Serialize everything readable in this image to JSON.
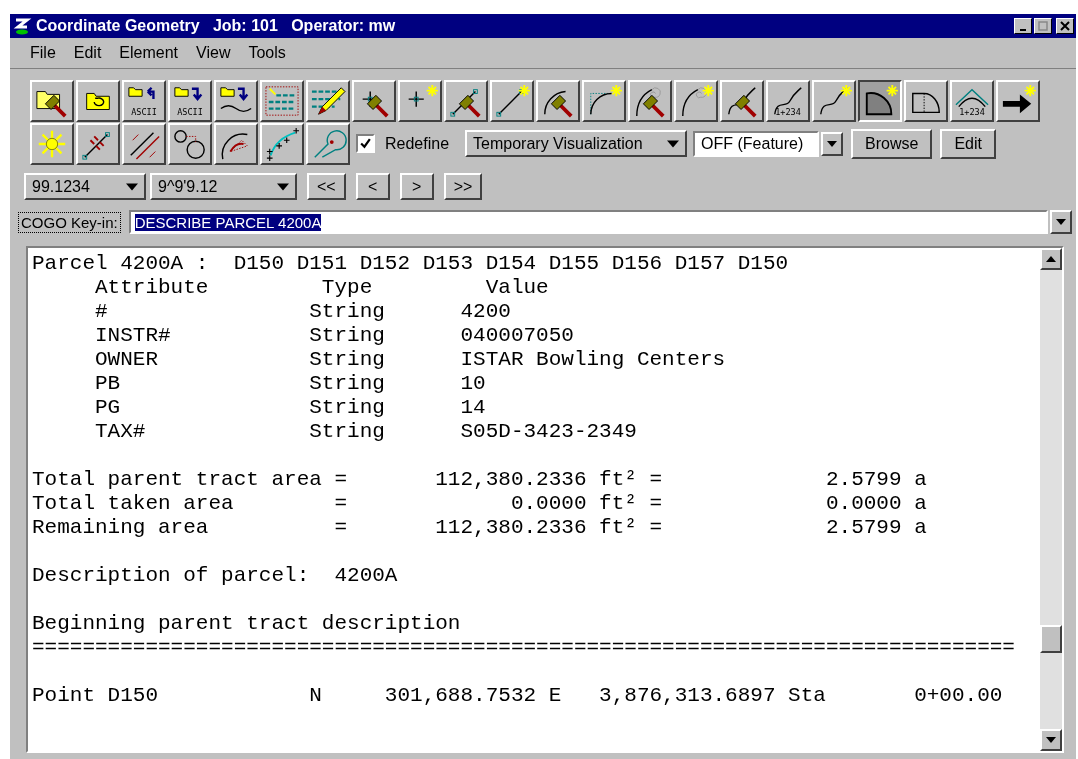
{
  "window": {
    "title": "Coordinate Geometry   Job: 101   Operator: mw"
  },
  "menu": [
    {
      "label": "File"
    },
    {
      "label": "Edit"
    },
    {
      "label": "Element"
    },
    {
      "label": "View"
    },
    {
      "label": "Tools"
    }
  ],
  "toolbar_rows": [
    [
      {
        "kind": "folder-hammer",
        "pressed": false
      },
      {
        "kind": "folder-undo",
        "pressed": false
      },
      {
        "kind": "ascii-export",
        "caption": "ASCII",
        "pressed": false
      },
      {
        "kind": "ascii-import",
        "caption": "ASCII",
        "pressed": false
      },
      {
        "kind": "folder-curve",
        "pressed": false
      },
      {
        "kind": "dotted-grid",
        "pressed": false
      },
      {
        "kind": "grid-pencil",
        "pressed": false
      },
      {
        "kind": "point-hammer",
        "pressed": false
      },
      {
        "kind": "point-star",
        "pressed": false
      },
      {
        "kind": "line-hammer",
        "pressed": false
      },
      {
        "kind": "line-star",
        "pressed": false
      },
      {
        "kind": "arc-hammer",
        "pressed": false
      },
      {
        "kind": "arc-star",
        "pressed": false
      },
      {
        "kind": "spiral-hammer",
        "pressed": false
      },
      {
        "kind": "spiral-star",
        "pressed": false
      },
      {
        "kind": "curve-hammer",
        "pressed": false
      },
      {
        "kind": "curve-station",
        "caption": "1+234",
        "pressed": false
      },
      {
        "kind": "curve-star",
        "pressed": false
      },
      {
        "kind": "sector-star",
        "pressed": true
      },
      {
        "kind": "sector",
        "pressed": false
      },
      {
        "kind": "tangent-station",
        "caption": "1+234",
        "pressed": false
      },
      {
        "kind": "arrow-star",
        "pressed": false
      }
    ],
    [
      {
        "kind": "sun",
        "pressed": false
      },
      {
        "kind": "line-hash",
        "pressed": false
      },
      {
        "kind": "line-offset",
        "pressed": false
      },
      {
        "kind": "circles",
        "pressed": false
      },
      {
        "kind": "arc-arrow",
        "pressed": false
      },
      {
        "kind": "plus-curve",
        "pressed": false
      },
      {
        "kind": "loop",
        "pressed": false
      }
    ]
  ],
  "redefine": {
    "label": "Redefine",
    "checked": true
  },
  "visualization": {
    "value": "Temporary Visualization"
  },
  "feature": {
    "value": "OFF (Feature)"
  },
  "buttons": [
    {
      "label": "Browse"
    },
    {
      "label": "Edit"
    }
  ],
  "distance_format": {
    "value": "99.1234"
  },
  "angle_format": {
    "value": "9^9'9.12"
  },
  "nav_buttons": [
    {
      "label": "<<"
    },
    {
      "label": "<"
    },
    {
      "label": ">"
    },
    {
      "label": ">>"
    }
  ],
  "keyin": {
    "label": "COGO Key-in:",
    "value": "DESCRIBE PARCEL 4200A",
    "selected": true
  },
  "output": {
    "blocks": [
      [
        "Parcel 4200A :  D150 D151 D152 D153 D154 D155 D156 D157 D150",
        "     Attribute         Type         Value",
        "     #                String      4200",
        "     INSTR#           String      040007050",
        "     OWNER            String      ISTAR Bowling Centers",
        "     PB               String      10",
        "     PG               String      14",
        "     TAX#             String      S05D-3423-2349"
      ],
      [
        "Total parent tract area =       112,380.2336 ft² =             2.5799 a",
        "Total taken area        =             0.0000 ft² =             0.0000 a",
        "Remaining area          =       112,380.2336 ft² =             2.5799 a"
      ],
      [
        "Description of parcel:  4200A"
      ],
      [
        "Beginning parent tract description",
        "=============================================================================="
      ],
      [
        "Point D150            N     301,688.7532 E   3,876,313.6897 Sta       0+00.00"
      ]
    ]
  }
}
